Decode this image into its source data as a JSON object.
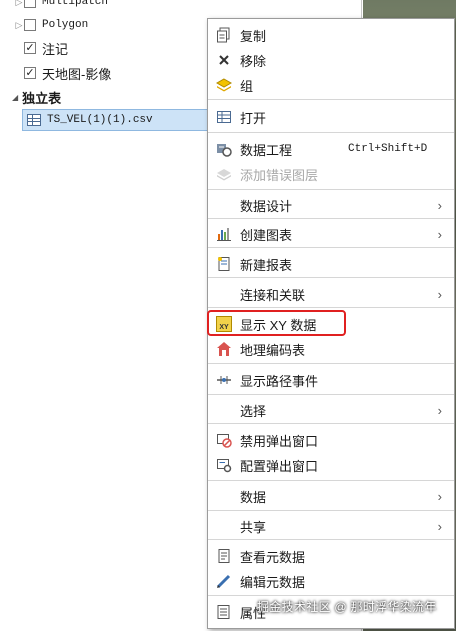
{
  "tree": {
    "items": [
      {
        "label": "Multipatch",
        "checked": false,
        "expander": "▷"
      },
      {
        "label": "Polygon",
        "checked": false,
        "expander": "▷"
      },
      {
        "label": "注记",
        "checked": true,
        "expander": ""
      },
      {
        "label": "天地图-影像",
        "checked": true,
        "expander": ""
      }
    ],
    "group_label": "独立表",
    "group_expander": "◢",
    "selected_table": "TS_VEL(1)(1).csv",
    "checkmark": "✓"
  },
  "menu": {
    "items": [
      {
        "label": "复制",
        "icon": "copy-icon"
      },
      {
        "label": "移除",
        "icon": "remove-icon"
      },
      {
        "label": "组",
        "icon": "group-icon"
      },
      {
        "label": "打开",
        "icon": "table-open-icon"
      },
      {
        "label": "数据工程",
        "icon": "data-engineering-icon",
        "shortcut": "Ctrl+Shift+D"
      },
      {
        "label": "添加错误图层",
        "icon": "error-layer-icon",
        "disabled": true
      },
      {
        "label": "数据设计",
        "submenu": true
      },
      {
        "label": "创建图表",
        "icon": "chart-icon",
        "submenu": true
      },
      {
        "label": "新建报表",
        "icon": "report-icon"
      },
      {
        "label": "连接和关联",
        "submenu": true
      },
      {
        "label": "显示 XY 数据",
        "icon": "xy-data-icon"
      },
      {
        "label": "地理编码表",
        "icon": "geocode-icon"
      },
      {
        "label": "显示路径事件",
        "icon": "route-events-icon"
      },
      {
        "label": "选择",
        "submenu": true
      },
      {
        "label": "禁用弹出窗口",
        "icon": "disable-popup-icon"
      },
      {
        "label": "配置弹出窗口",
        "icon": "configure-popup-icon"
      },
      {
        "label": "数据",
        "submenu": true
      },
      {
        "label": "共享",
        "submenu": true
      },
      {
        "label": "查看元数据",
        "icon": "view-metadata-icon"
      },
      {
        "label": "编辑元数据",
        "icon": "edit-metadata-icon"
      },
      {
        "label": "属性",
        "icon": "properties-icon"
      }
    ],
    "arrow": "›"
  },
  "xy_icon_text": "XY",
  "watermark": "掘金技术社区 @ 那时浮华染流年",
  "colors": {
    "highlight": "#e02020",
    "selection": "#cde3f7"
  }
}
